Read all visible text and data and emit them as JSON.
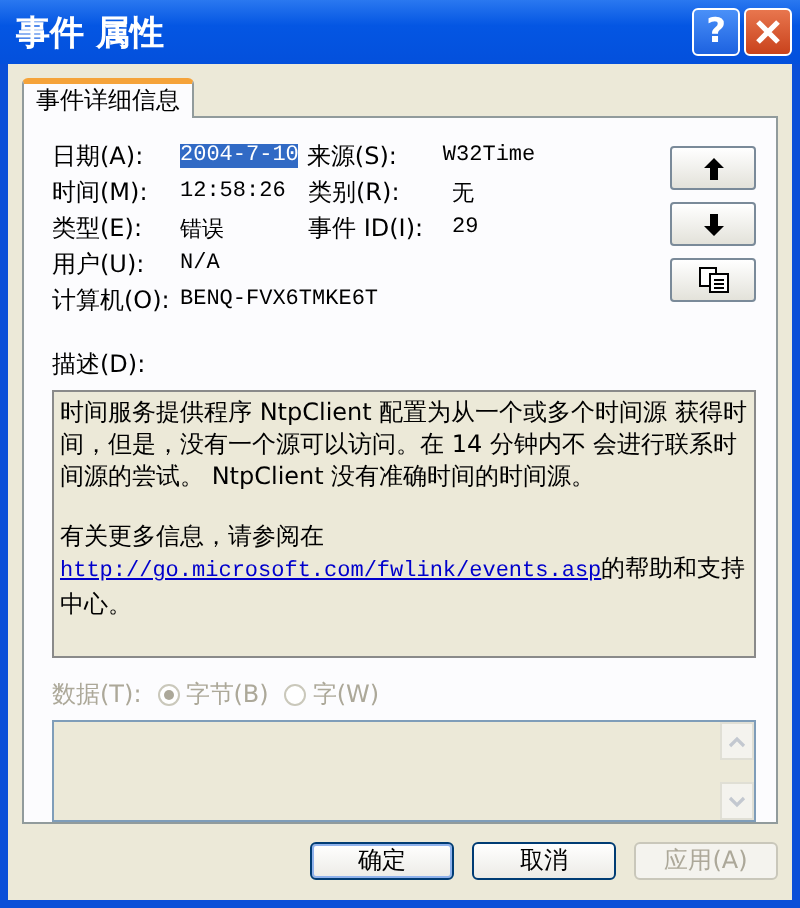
{
  "window": {
    "title": "事件 属性",
    "help": "?"
  },
  "tabs": [
    {
      "label": "事件详细信息",
      "selected": true
    }
  ],
  "rows": [
    {
      "cells": [
        {
          "label": "日期(A):",
          "value": "2004-7-10",
          "highlighted": true
        },
        {
          "label": "来源(S):",
          "value": "W32Time",
          "highlighted": false
        }
      ]
    },
    {
      "cells": [
        {
          "label": "时间(M):",
          "value": "12:58:26",
          "highlighted": false
        },
        {
          "label": "类别(R):",
          "value": "无",
          "highlighted": false
        }
      ]
    },
    {
      "cells": [
        {
          "label": "类型(E):",
          "value": "错误",
          "highlighted": false
        },
        {
          "label": "事件 ID(I):",
          "value": "29",
          "highlighted": false
        }
      ]
    },
    {
      "cells": [
        {
          "label": "用户(U):",
          "value": "N/A",
          "highlighted": false
        }
      ]
    },
    {
      "cells": [
        {
          "label": "计算机(O):",
          "value": "BENQ-FVX6TMKE6T",
          "highlighted": false
        }
      ]
    }
  ],
  "side_buttons": [
    {
      "kind": "up"
    },
    {
      "kind": "down"
    },
    {
      "kind": "copy"
    }
  ],
  "description": {
    "label": "描述(D):",
    "paragraphs": [
      {
        "text": "时间服务提供程序 NtpClient 配置为从一个或多个时间源 获得时间，但是，没有一个源可以访问。在 14 分钟内不 会进行联系时间源的尝试。 NtpClient 没有准确时间的时间源。"
      },
      {
        "text": "有关更多信息，请参阅在",
        "link": "http://go.microsoft.com/fwlink/events.asp",
        "after": "的帮助和支持中心。"
      }
    ]
  },
  "data": {
    "label": "数据(T):",
    "disabled": true,
    "options": [
      {
        "label": "字节(B)",
        "selected": true
      },
      {
        "label": "字(W)",
        "selected": false
      }
    ]
  },
  "buttons": [
    {
      "label": "确定",
      "default": true,
      "disabled": false
    },
    {
      "label": "取消",
      "default": false,
      "disabled": false
    },
    {
      "label": "应用(A)",
      "default": false,
      "disabled": true
    }
  ]
}
